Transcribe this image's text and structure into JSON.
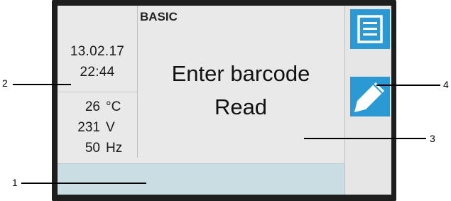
{
  "screen": {
    "mode": "BASIC",
    "date": "13.02.17",
    "time": "22:44",
    "measurements": [
      {
        "value": "26",
        "unit": "°C"
      },
      {
        "value": "231",
        "unit": "V"
      },
      {
        "value": "50",
        "unit": "Hz"
      }
    ],
    "message_line1": "Enter barcode",
    "message_line2": "Read",
    "status_text": ""
  },
  "buttons": {
    "menu_icon": "list-menu-icon",
    "edit_icon": "pencil-icon"
  },
  "callouts": [
    "1",
    "2",
    "3",
    "4"
  ],
  "colors": {
    "button_blue": "#2b9ad4",
    "screen_bg": "#e8e9e8",
    "status_bar": "#c9dde2",
    "bezel": "#1e1e1e"
  }
}
